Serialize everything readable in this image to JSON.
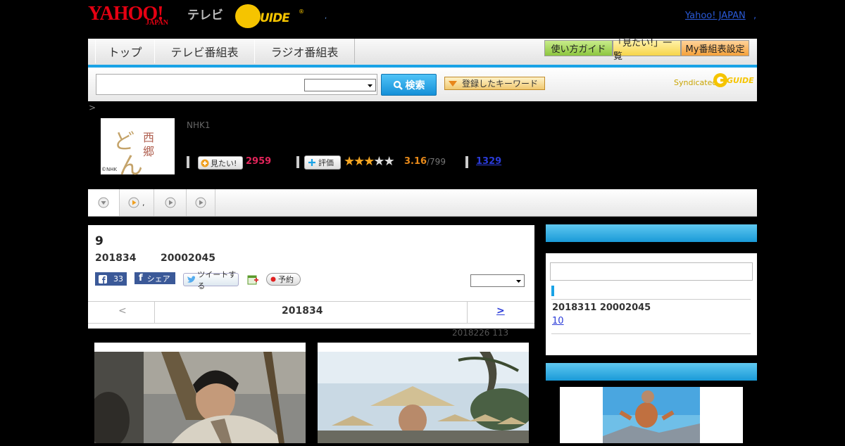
{
  "header": {
    "logo_yahoo": "YAHOO!",
    "logo_japan": "JAPAN",
    "logo_tv": "テレビ",
    "logo_gguide": "GUIDE",
    "logo_gguide_reg": "®",
    "dot": ",",
    "yahoo_japan_link": "Yahoo! JAPAN",
    "trailing_dot": ","
  },
  "nav": {
    "tabs": [
      {
        "label": "トップ"
      },
      {
        "label": "テレビ番組表"
      },
      {
        "label": "ラジオ番組表"
      }
    ],
    "buttons": [
      {
        "label": "使い方ガイド",
        "color": "#8dc63f"
      },
      {
        "label": "「見たい!」一覧",
        "color": "#f7d54a"
      },
      {
        "label": "My番組表設定",
        "color": "#f5a13a"
      }
    ]
  },
  "search": {
    "button_label": "検索",
    "keyword_button_label": "登録したキーワード",
    "syndicated_label": "Syndicated",
    "syndicated_logo": "GUIDE"
  },
  "program": {
    "breadcrumb": ">",
    "thumb_chars": [
      "西",
      "郷",
      "ど",
      "ん"
    ],
    "thumb_credit": "©NHK",
    "channel": "NHK1",
    "want_label": "見たい!",
    "want_count": "2959",
    "rate_label": "評価",
    "rating": 3.16,
    "rating_max": 5,
    "score": "3.16",
    "score_count": "/799",
    "review_count": "1329"
  },
  "tabs": [
    {
      "icon": "down-arrow-icon",
      "label": ""
    },
    {
      "icon": "play-icon",
      "label": ","
    },
    {
      "icon": "play-icon",
      "label": ""
    },
    {
      "icon": "play-icon",
      "label": ""
    }
  ],
  "episode": {
    "number": "9",
    "date": "201834",
    "id": "20002045",
    "fb_count": "33",
    "fb_share": "シェア",
    "tweet": "ツイートする",
    "reserve": "予約",
    "prev": "<",
    "pager_title": "201834",
    "next": ">",
    "meta": "2018226  113"
  },
  "sidebar": {
    "item_text": "2018311  20002045",
    "link_text": "10"
  },
  "colors": {
    "accent": "#1aa3e6",
    "want": "#e2245a",
    "score": "#e88a1a",
    "link": "#2a3bd8"
  }
}
